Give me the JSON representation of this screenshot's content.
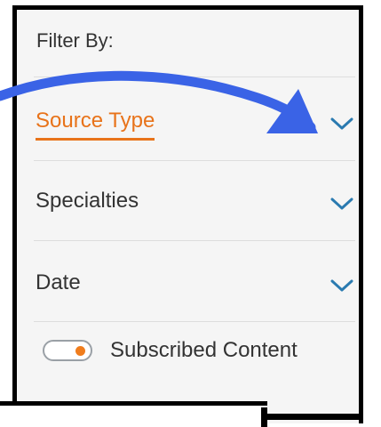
{
  "filter": {
    "title": "Filter By:",
    "items": [
      {
        "label": "Source Type",
        "active": true,
        "icon": "chevron-down-icon"
      },
      {
        "label": "Specialties",
        "active": false,
        "icon": "chevron-down-icon"
      },
      {
        "label": "Date",
        "active": false,
        "icon": "chevron-down-icon"
      }
    ],
    "toggle": {
      "label": "Subscribed Content",
      "on": true
    }
  },
  "colors": {
    "accent": "#e8731a",
    "chevron": "#2a7ab0",
    "annotation_arrow": "#3a63e6"
  }
}
